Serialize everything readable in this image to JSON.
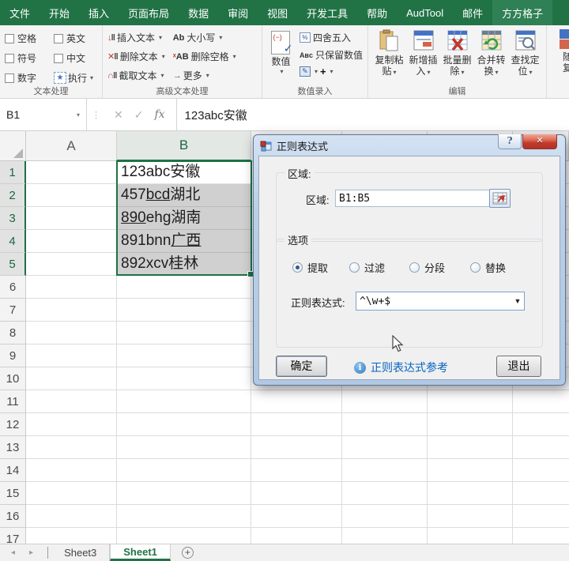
{
  "ribbon": {
    "tabs": [
      {
        "label": "文件",
        "active": false
      },
      {
        "label": "开始",
        "active": false
      },
      {
        "label": "插入",
        "active": false
      },
      {
        "label": "页面布局",
        "active": false
      },
      {
        "label": "数据",
        "active": false
      },
      {
        "label": "审阅",
        "active": false
      },
      {
        "label": "视图",
        "active": false
      },
      {
        "label": "开发工具",
        "active": false
      },
      {
        "label": "帮助",
        "active": false
      },
      {
        "label": "AudTool",
        "active": false
      },
      {
        "label": "邮件",
        "active": false
      },
      {
        "label": "方方格子",
        "active": true
      }
    ],
    "groups": {
      "text_processing": {
        "label": "文本处理",
        "checkboxes": [
          "空格",
          "英文",
          "符号",
          "中文",
          "数字"
        ],
        "execute_label": "执行"
      },
      "advanced_text": {
        "label": "高级文本处理",
        "items": [
          "插入文本",
          "删除文本",
          "截取文本",
          "大小写",
          "删除空格",
          "更多"
        ]
      },
      "numeric_entry": {
        "label": "数值录入",
        "big_button": "数值",
        "items": [
          "四舍五入",
          "只保留数值"
        ],
        "plus_label": "+"
      },
      "edit": {
        "label": "编辑",
        "buttons": [
          [
            "复制粘",
            "贴"
          ],
          [
            "新增插",
            "入"
          ],
          [
            "批量删",
            "除"
          ],
          [
            "合并转",
            "换"
          ],
          [
            "查找定",
            "位"
          ]
        ]
      },
      "partial": {
        "line1": "随",
        "line2": "复"
      }
    }
  },
  "formula_bar": {
    "name_box": "B1",
    "fx_label": "fx",
    "value": "123abc安徽"
  },
  "grid": {
    "col_headers": [
      "A",
      "B"
    ],
    "row_headers": [
      "1",
      "2",
      "3",
      "4",
      "5",
      "6",
      "7",
      "8",
      "9",
      "10",
      "11",
      "12",
      "13",
      "14",
      "15",
      "16",
      "17"
    ],
    "cells": [
      {
        "pre": "123abc安徽",
        "u": "",
        "post": ""
      },
      {
        "pre": "457",
        "u": "bcd",
        "post": "湖北"
      },
      {
        "pre": "",
        "u": "890",
        "post": "ehg湖南"
      },
      {
        "pre": "891bnn",
        "u": "广西",
        "post": ""
      },
      {
        "pre": "892xcv桂林",
        "u": "",
        "post": ""
      }
    ]
  },
  "dialog": {
    "title": "正则表达式",
    "help_label": "?",
    "region_group_label": "区域:",
    "region_label": "区域:",
    "region_value": "B1:B5",
    "options_group_label": "选项",
    "radios": [
      {
        "label": "提取",
        "selected": true
      },
      {
        "label": "过滤",
        "selected": false
      },
      {
        "label": "分段",
        "selected": false
      },
      {
        "label": "替换",
        "selected": false
      }
    ],
    "regex_label": "正则表达式:",
    "regex_value": "^\\w+$",
    "ok_label": "确定",
    "reference_link": "正则表达式参考",
    "exit_label": "退出"
  },
  "sheet_bar": {
    "tabs": [
      {
        "label": "Sheet3",
        "active": false
      },
      {
        "label": "Sheet1",
        "active": true
      }
    ]
  },
  "colors": {
    "excel_green": "#217346",
    "selection_green": "#1e7145",
    "close_red": "#c33b2e",
    "link_blue": "#0563c1"
  }
}
